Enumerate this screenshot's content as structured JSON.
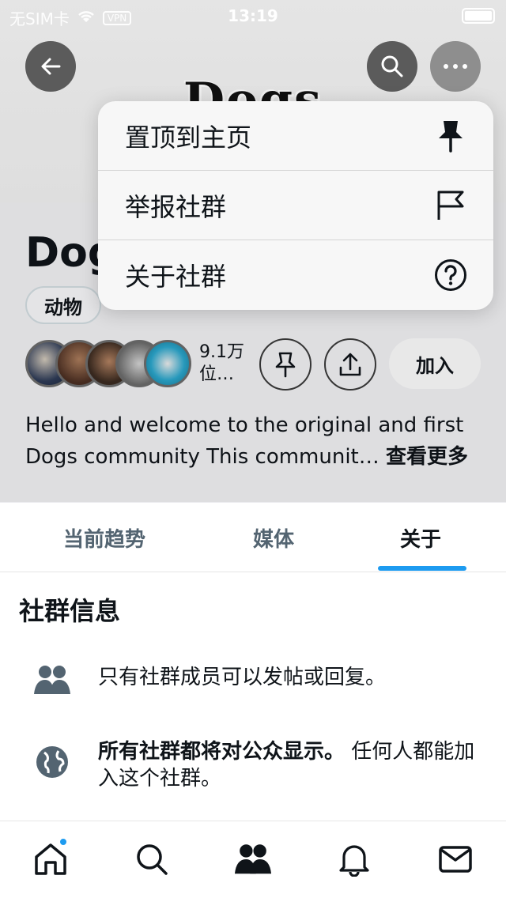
{
  "status_bar": {
    "carrier": "无SIM卡",
    "vpn": "VPN",
    "time": "13:19"
  },
  "banner": {
    "logo_text": "Dogs"
  },
  "community": {
    "title": "Dogs",
    "tag": "动物",
    "members": "9.1万",
    "members_unit": "位…",
    "join_label": "加入",
    "description": "Hello and welcome to the original and first Dogs community This communit…",
    "see_more": "查看更多"
  },
  "menu": {
    "items": [
      {
        "label": "置顶到主页",
        "icon": "pin-icon"
      },
      {
        "label": "举报社群",
        "icon": "flag-icon"
      },
      {
        "label": "关于社群",
        "icon": "help-icon"
      }
    ]
  },
  "tabs": [
    {
      "label": "当前趋势",
      "active": false
    },
    {
      "label": "媒体",
      "active": false
    },
    {
      "label": "关于",
      "active": true
    }
  ],
  "about": {
    "section_title": "社群信息",
    "rules": [
      {
        "icon": "people-icon",
        "text": "只有社群成员可以发帖或回复。"
      },
      {
        "icon": "globe-icon",
        "bold": "所有社群都将对公众显示。",
        "text": " 任何人都能加入这个社群。"
      }
    ]
  },
  "colors": {
    "accent": "#1d9bf0",
    "text": "#0f1419",
    "muted": "#536471"
  }
}
